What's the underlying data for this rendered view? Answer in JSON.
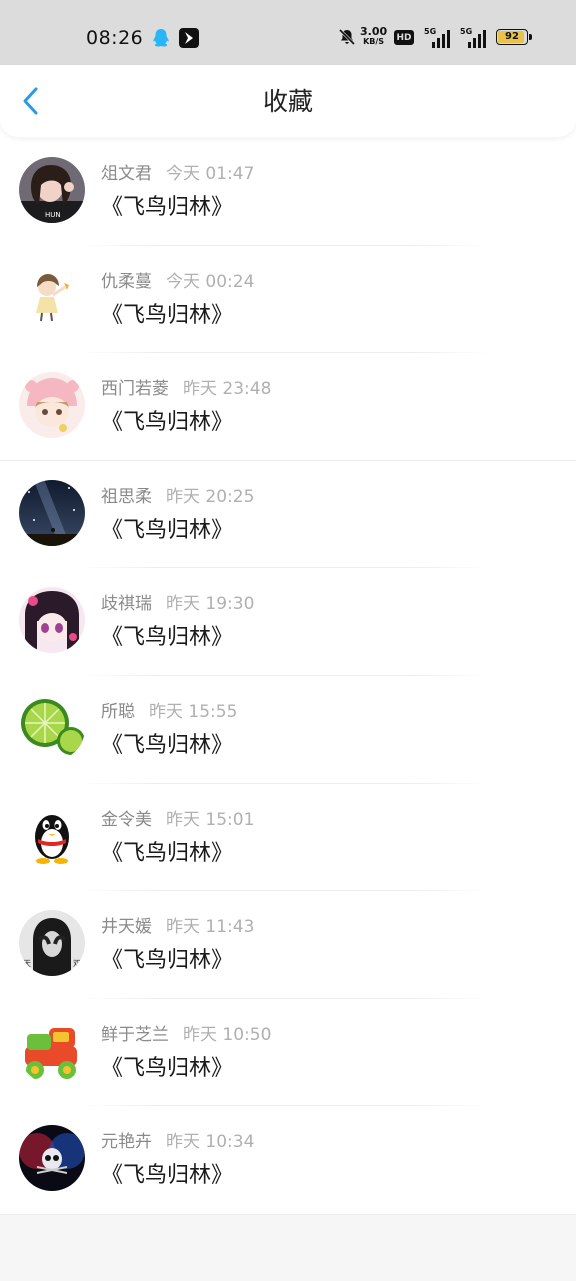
{
  "status_bar": {
    "time": "08:26",
    "net_speed_value": "3.00",
    "net_speed_unit": "KB/S",
    "hd_label": "HD",
    "signal1_label": "5G",
    "signal2_label": "5G",
    "battery": "92",
    "battery_color": "#e8c24a"
  },
  "header": {
    "title": "收藏",
    "back_icon": "chevron-left-icon",
    "accent_color": "#2a9ae8"
  },
  "items": [
    {
      "name": "俎文君",
      "time": "今天 01:47",
      "content": "《飞鸟归林》",
      "avatar": "avatar-girl-photo"
    },
    {
      "name": "仇柔蔓",
      "time": "今天 00:24",
      "content": "《飞鸟归林》",
      "avatar": "avatar-cartoon-girl"
    },
    {
      "name": "西门若菱",
      "time": "昨天 23:48",
      "content": "《飞鸟归林》",
      "avatar": "avatar-pink-hood-girl"
    },
    {
      "name": "祖思柔",
      "time": "昨天 20:25",
      "content": "《飞鸟归林》",
      "avatar": "avatar-night-sky"
    },
    {
      "name": "歧祺瑞",
      "time": "昨天 19:30",
      "content": "《飞鸟归林》",
      "avatar": "avatar-anime-girl"
    },
    {
      "name": "所聪",
      "time": "昨天 15:55",
      "content": "《飞鸟归林》",
      "avatar": "avatar-lime"
    },
    {
      "name": "金令美",
      "time": "昨天 15:01",
      "content": "《飞鸟归林》",
      "avatar": "avatar-qq-penguin"
    },
    {
      "name": "井天媛",
      "time": "昨天 11:43",
      "content": "《飞鸟归林》",
      "avatar": "avatar-bw-photo"
    },
    {
      "name": "鲜于芝兰",
      "time": "昨天 10:50",
      "content": "《飞鸟归林》",
      "avatar": "avatar-toy-truck"
    },
    {
      "name": "元艳卉",
      "time": "昨天 10:34",
      "content": "《飞鸟归林》",
      "avatar": "avatar-skull-dark"
    }
  ]
}
